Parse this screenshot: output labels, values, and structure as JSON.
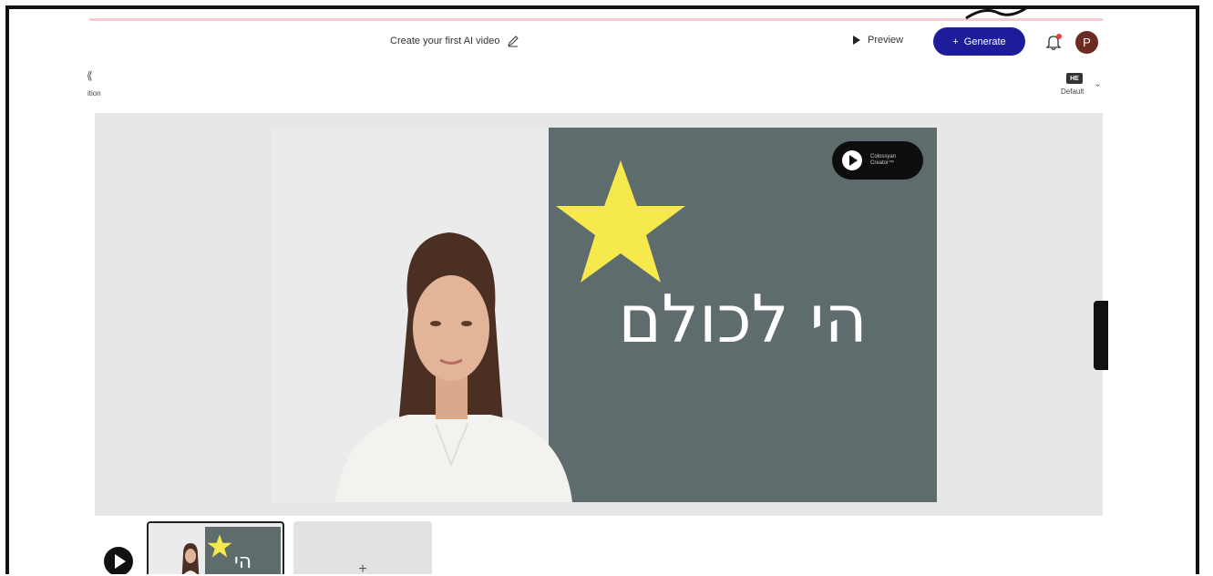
{
  "header": {
    "title": "Create your first AI video",
    "preview_label": "Preview",
    "generate_label": "Generate",
    "generate_plus": "+",
    "avatar_initial": "P",
    "brand_color": "#1d1d9c"
  },
  "toolbar": {
    "transition_label": "ition",
    "language_code": "HE",
    "language_default": "Default"
  },
  "slide": {
    "hebrew_text": "הי לכולם",
    "logo_line1": "Colossyan",
    "logo_line2": "Creator™",
    "background_color": "#5f6c6d",
    "star_color": "#f5e94b"
  },
  "timeline": {
    "thumb_text": "הי לכולם",
    "add_scene_label": "+"
  }
}
